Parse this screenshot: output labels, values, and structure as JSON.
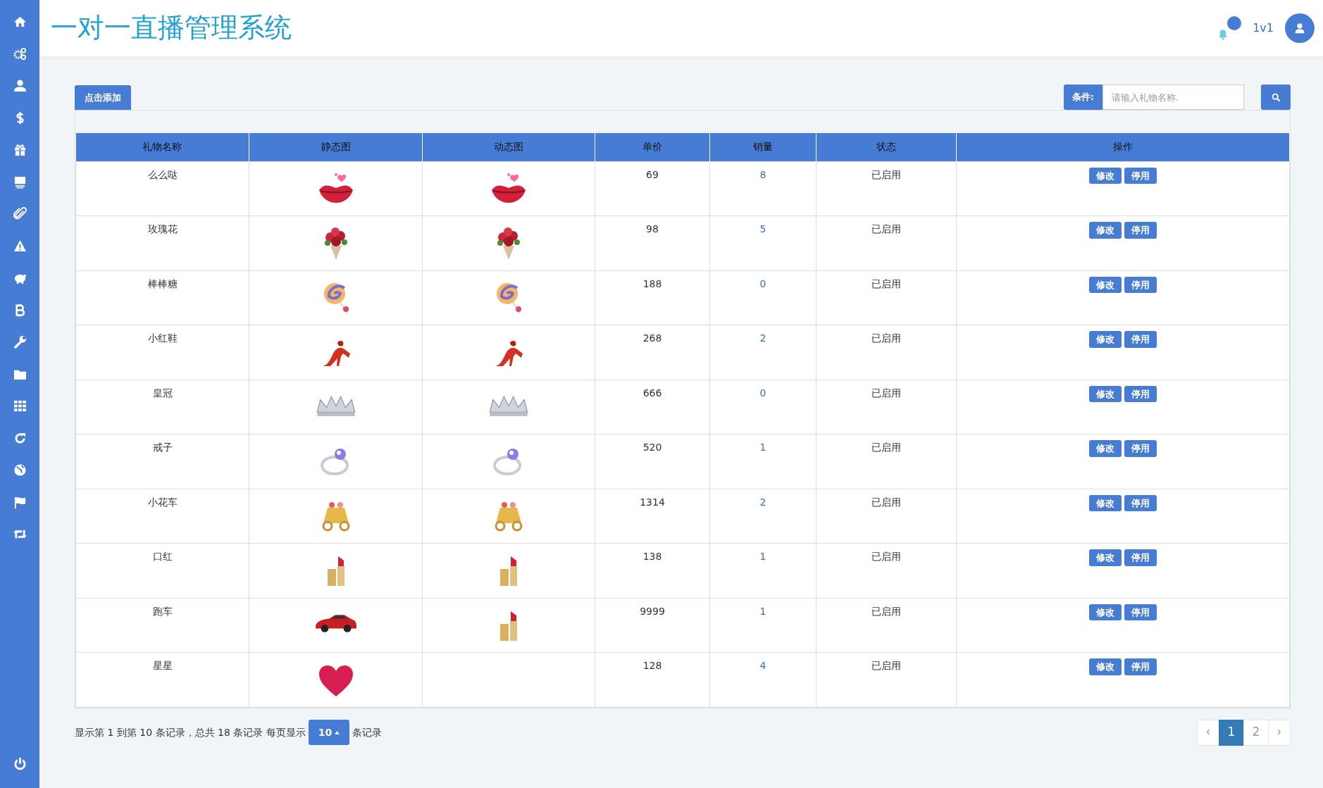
{
  "header": {
    "title": "一对一直播管理系统",
    "notification_badge": true,
    "username": "1v1"
  },
  "toolbar": {
    "add_button": "点击添加",
    "search_label": "条件:",
    "search_placeholder": "请输入礼物名称."
  },
  "table": {
    "columns": [
      "礼物名称",
      "静态图",
      "动态图",
      "单价",
      "销量",
      "状态",
      "操作"
    ],
    "rows": [
      {
        "name": "么么哒",
        "static_image": {
          "kind": "lips"
        },
        "animated_image": {
          "kind": "lips"
        },
        "price": "69",
        "sales": "8",
        "status": "已启用",
        "actions": [
          "修改",
          "停用"
        ]
      },
      {
        "name": "玫瑰花",
        "static_image": {
          "kind": "bouquet"
        },
        "animated_image": {
          "kind": "bouquet"
        },
        "price": "98",
        "sales": "5",
        "status": "已启用",
        "actions": [
          "修改",
          "停用"
        ]
      },
      {
        "name": "棒棒糖",
        "static_image": {
          "kind": "lollipop"
        },
        "animated_image": {
          "kind": "lollipop"
        },
        "price": "188",
        "sales": "0",
        "status": "已启用",
        "actions": [
          "修改",
          "停用"
        ]
      },
      {
        "name": "小红鞋",
        "static_image": {
          "kind": "shoe"
        },
        "animated_image": {
          "kind": "shoe"
        },
        "price": "268",
        "sales": "2",
        "status": "已启用",
        "actions": [
          "修改",
          "停用"
        ]
      },
      {
        "name": "皇冠",
        "static_image": {
          "kind": "crown"
        },
        "animated_image": {
          "kind": "crown"
        },
        "price": "666",
        "sales": "0",
        "status": "已启用",
        "actions": [
          "修改",
          "停用"
        ]
      },
      {
        "name": "戒子",
        "static_image": {
          "kind": "ring"
        },
        "animated_image": {
          "kind": "ring"
        },
        "price": "520",
        "sales": "1",
        "status": "已启用",
        "actions": [
          "修改",
          "停用"
        ]
      },
      {
        "name": "小花车",
        "static_image": {
          "kind": "carriage"
        },
        "animated_image": {
          "kind": "carriage"
        },
        "price": "1314",
        "sales": "2",
        "status": "已启用",
        "actions": [
          "修改",
          "停用"
        ]
      },
      {
        "name": "口红",
        "static_image": {
          "kind": "lipstick"
        },
        "animated_image": {
          "kind": "lipstick"
        },
        "price": "138",
        "sales": "1",
        "status": "已启用",
        "actions": [
          "修改",
          "停用"
        ]
      },
      {
        "name": "跑车",
        "static_image": {
          "kind": "car"
        },
        "animated_image": {
          "kind": "lipstick"
        },
        "price": "9999",
        "sales": "1",
        "status": "已启用",
        "actions": [
          "修改",
          "停用"
        ]
      },
      {
        "name": "星星",
        "static_image": {
          "kind": "heart"
        },
        "price": "128",
        "sales": "4",
        "status": "已启用",
        "actions": [
          "修改",
          "停用"
        ]
      }
    ]
  },
  "footer": {
    "summary": "显示第 1 到第 10 条记录，总共 18 条记录 每页显示",
    "page_size": "10",
    "summary_end": "条记录"
  },
  "pagination": {
    "prev": "‹",
    "pages": [
      {
        "label": "1",
        "selected": true
      },
      {
        "label": "2",
        "selected": false
      }
    ],
    "next": "›"
  }
}
